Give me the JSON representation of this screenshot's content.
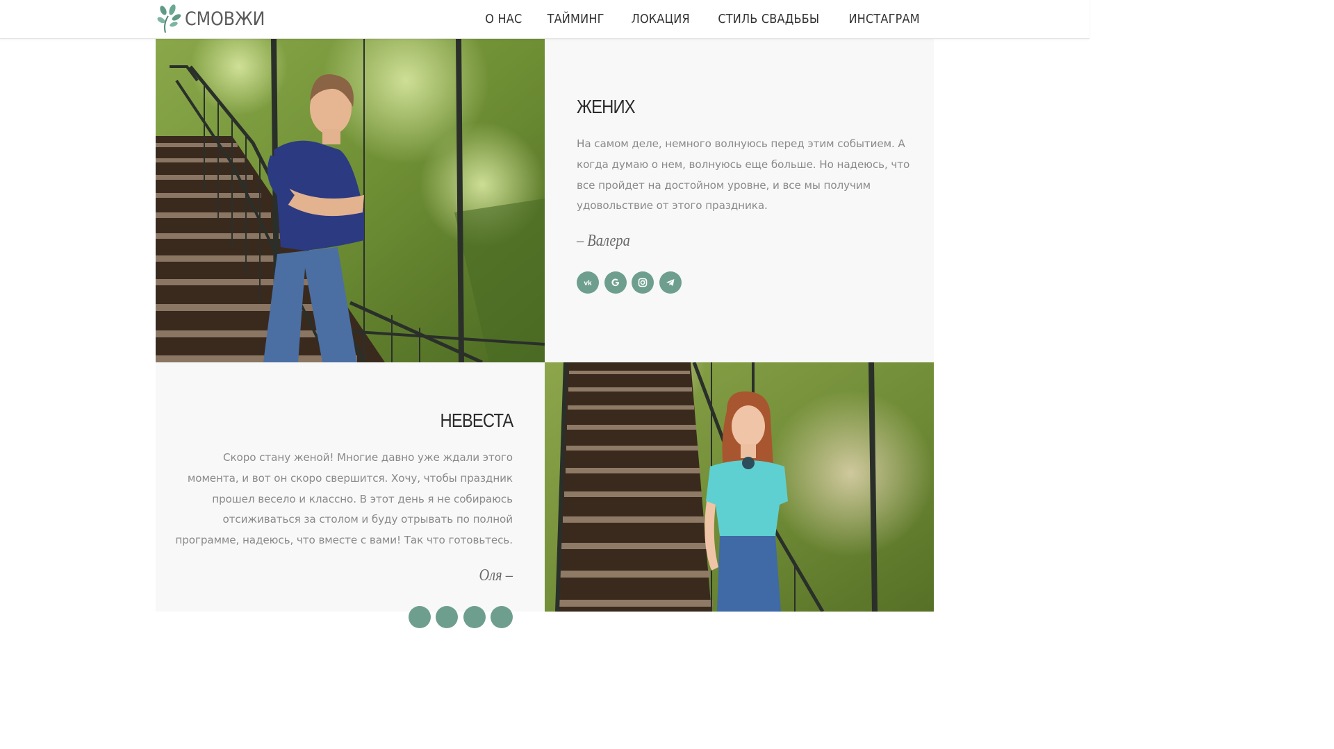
{
  "header": {
    "logo_text": "СМОВЖИ",
    "nav": [
      "О НАС",
      "ТАЙМИНГ",
      "ЛОКАЦИЯ",
      "СТИЛЬ СВАДЬБЫ",
      "ИНСТАГРАМ"
    ]
  },
  "groom": {
    "title": "ЖЕНИХ",
    "quote": "На самом деле, немного волнуюсь перед этим событием. А когда думаю о нем, волнуюсь еще больше. Но надеюсь, что все пройдет на достойном уровне, и все мы получим удовольствие от этого праздника.",
    "signature": "– Валера",
    "socials": [
      "vk-icon",
      "google-icon",
      "instagram-icon",
      "telegram-icon"
    ],
    "photo": "groom-photo"
  },
  "bride": {
    "title": "НЕВЕСТА",
    "quote": "Скоро стану женой! Многие давно уже ждали этого момента, и вот он скоро свершится. Хочу, чтобы праздник прошел весело и классно. В этот день я не собираюсь отсиживаться за столом и буду отрывать по полной программе, надеюсь, что вместе с вами! Так что готовьтесь.",
    "signature": "Оля –",
    "socials": [
      "vk-icon",
      "google-icon",
      "instagram-icon",
      "telegram-icon"
    ],
    "photo": "bride-photo"
  },
  "colors": {
    "accent": "#6e9f8e",
    "panel_bg": "#f7f8f7",
    "text_muted": "#8a8a8a"
  }
}
